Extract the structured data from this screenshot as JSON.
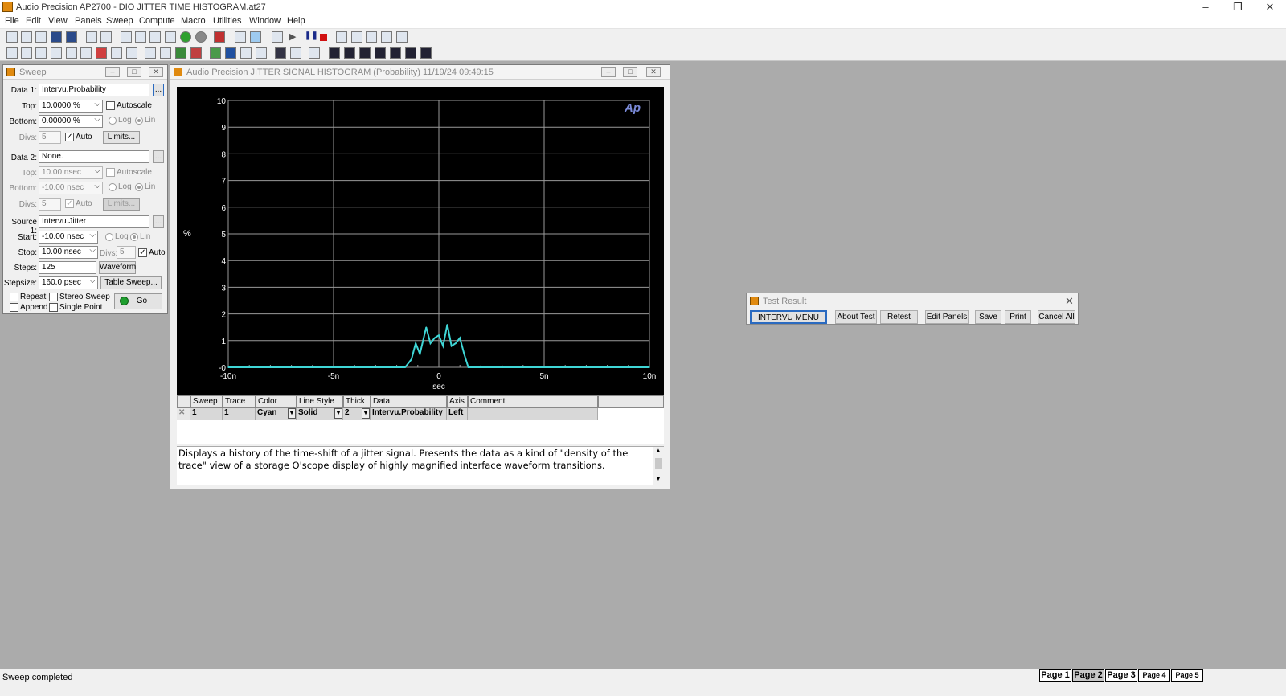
{
  "app": {
    "title": "Audio Precision AP2700 - DIO JITTER TIME HISTOGRAM.at27",
    "window_controls": {
      "minimize": "–",
      "restore": "❐",
      "close": "✕"
    }
  },
  "menu": [
    "File",
    "Edit",
    "View",
    "Panels",
    "Sweep",
    "Compute",
    "Macro",
    "Utilities",
    "Window",
    "Help"
  ],
  "sweep_panel": {
    "title": "Sweep",
    "data1": {
      "label": "Data 1:",
      "value": "Intervu.Probability",
      "browse": "..."
    },
    "top1": {
      "label": "Top:",
      "value": "10.0000  %",
      "autoscale": "Autoscale",
      "autoscale_checked": false
    },
    "bottom1": {
      "label": "Bottom:",
      "value": "0.00000  %",
      "log": "Log",
      "lin": "Lin"
    },
    "divs1": {
      "label": "Divs:",
      "value": "5",
      "auto": "Auto",
      "auto_checked": true,
      "limits": "Limits..."
    },
    "data2": {
      "label": "Data 2:",
      "value": "None.",
      "browse": "..."
    },
    "top2": {
      "label": "Top:",
      "value": "10.00   nsec",
      "autoscale": "Autoscale"
    },
    "bottom2": {
      "label": "Bottom:",
      "value": "-10.00  nsec",
      "log": "Log",
      "lin": "Lin"
    },
    "divs2": {
      "label": "Divs:",
      "value": "5",
      "auto": "Auto",
      "limits": "Limits..."
    },
    "source1": {
      "label": "Source 1:",
      "value": "Intervu.Jitter",
      "browse": "..."
    },
    "start": {
      "label": "Start:",
      "value": "-10.00  nsec",
      "log": "Log",
      "lin": "Lin"
    },
    "stop": {
      "label": "Stop:",
      "value": "10.00   nsec",
      "divs_label": "Divs:",
      "divs_value": "5",
      "auto": "Auto",
      "auto_checked": true
    },
    "steps": {
      "label": "Steps:",
      "value": "125",
      "waveform": "Waveform"
    },
    "stepsize": {
      "label": "Stepsize:",
      "value": "160.0   psec",
      "table_sweep": "Table Sweep..."
    },
    "options": {
      "repeat": "Repeat",
      "stereo_sweep": "Stereo Sweep",
      "append": "Append",
      "single_point": "Single Point"
    },
    "go": "Go"
  },
  "graph_window": {
    "title": "Audio Precision  JITTER SIGNAL HISTOGRAM (Probability)    11/19/24 09:49:15",
    "logo": "Ap",
    "plot_colors": {
      "background": "#000000",
      "grid": "#9a9a9a",
      "trace": "#3fd6d6",
      "text": "#ffffff"
    },
    "table_headers": [
      "Sweep",
      "Trace",
      "Color",
      "Line Style",
      "Thick",
      "Data",
      "Axis",
      "Comment"
    ],
    "table_row": [
      "1",
      "1",
      "Cyan",
      "Solid",
      "2",
      "Intervu.Probability",
      "Left",
      ""
    ],
    "description": "Displays a history of the time-shift of a jitter signal.    Presents the data as a kind of \"density of the trace\" view of a storage O'scope display of  highly magnified interface waveform transitions."
  },
  "chart_data": {
    "type": "line",
    "title": "",
    "xlabel": "sec",
    "ylabel": "%",
    "xlim": [
      -10,
      10
    ],
    "ylim": [
      0,
      10
    ],
    "x_unit": "nsec",
    "xticks": [
      {
        "v": -10,
        "label": "-10n"
      },
      {
        "v": -5,
        "label": "-5n"
      },
      {
        "v": 0,
        "label": "0"
      },
      {
        "v": 5,
        "label": "5n"
      },
      {
        "v": 10,
        "label": "10n"
      }
    ],
    "yticks": [
      {
        "v": 0,
        "label": "-0"
      },
      {
        "v": 1,
        "label": "1"
      },
      {
        "v": 2,
        "label": "2"
      },
      {
        "v": 3,
        "label": "3"
      },
      {
        "v": 4,
        "label": "4"
      },
      {
        "v": 5,
        "label": "5"
      },
      {
        "v": 6,
        "label": "6"
      },
      {
        "v": 7,
        "label": "7"
      },
      {
        "v": 8,
        "label": "8"
      },
      {
        "v": 9,
        "label": "9"
      },
      {
        "v": 10,
        "label": "10"
      }
    ],
    "grid": true,
    "series": [
      {
        "color": "#3fd6d6",
        "x": [
          -10,
          -1.6,
          -1.3,
          -1.1,
          -0.9,
          -0.6,
          -0.4,
          -0.2,
          0,
          0.2,
          0.4,
          0.6,
          0.8,
          1.0,
          1.2,
          1.4,
          10
        ],
        "y": [
          0,
          0,
          0.3,
          0.9,
          0.5,
          1.5,
          0.9,
          1.1,
          1.2,
          0.8,
          1.6,
          0.8,
          0.9,
          1.1,
          0.5,
          0,
          0
        ]
      }
    ]
  },
  "test_result": {
    "title": "Test Result",
    "buttons": [
      "INTERVU  MENU",
      "About Test",
      "Retest",
      "Edit Panels",
      "Save",
      "Print",
      "Cancel All"
    ]
  },
  "status": {
    "text": "Sweep completed",
    "pages": [
      "Page 1",
      "Page 2",
      "Page 3",
      "Page 4",
      "Page 5"
    ],
    "active_page": "Page 2"
  }
}
